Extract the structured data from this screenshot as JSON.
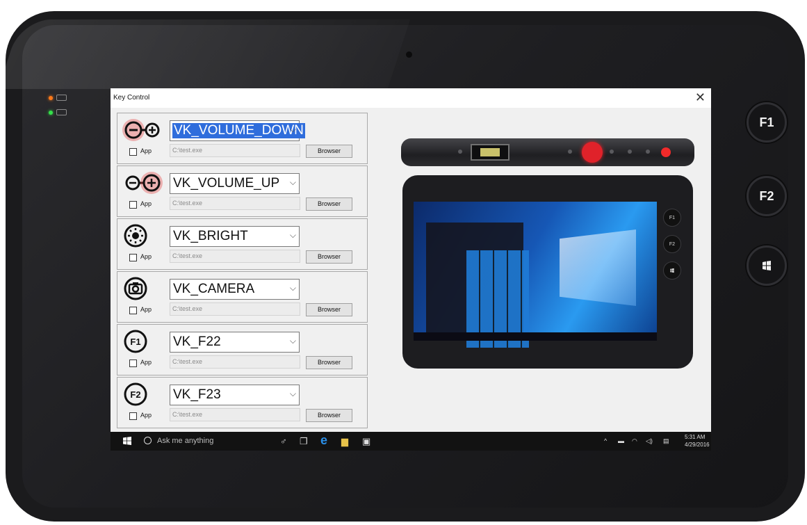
{
  "hardware": {
    "buttons": [
      {
        "id": "f1",
        "label": "F1"
      },
      {
        "id": "f2",
        "label": "F2"
      },
      {
        "id": "win",
        "icon": "windows-icon"
      }
    ]
  },
  "window": {
    "title": "Key Control",
    "close_icon": "close-icon"
  },
  "keys": [
    {
      "icon": "volume-down-icon",
      "value": "VK_VOLUME_DOWN",
      "selected": true,
      "app_label": "App",
      "path": "C:\\test.exe",
      "browse": "Browser"
    },
    {
      "icon": "volume-up-icon",
      "value": "VK_VOLUME_UP",
      "app_label": "App",
      "path": "C:\\test.exe",
      "browse": "Browser"
    },
    {
      "icon": "brightness-icon",
      "value": "VK_BRIGHT",
      "app_label": "App",
      "path": "C:\\test.exe",
      "browse": "Browser"
    },
    {
      "icon": "camera-icon",
      "value": "VK_CAMERA",
      "app_label": "App",
      "path": "C:\\test.exe",
      "browse": "Browser"
    },
    {
      "icon": "f1-icon",
      "icon_text": "F1",
      "value": "VK_F22",
      "app_label": "App",
      "path": "C:\\test.exe",
      "browse": "Browser"
    },
    {
      "icon": "f2-icon",
      "icon_text": "F2",
      "value": "VK_F23",
      "app_label": "App",
      "path": "C:\\test.exe",
      "browse": "Browser"
    }
  ],
  "device_image": {
    "side_buttons": [
      "F1",
      "F2"
    ]
  },
  "taskbar": {
    "search_text": "Ask me anything",
    "time": "5:31 AM",
    "date": "4/29/2016"
  }
}
